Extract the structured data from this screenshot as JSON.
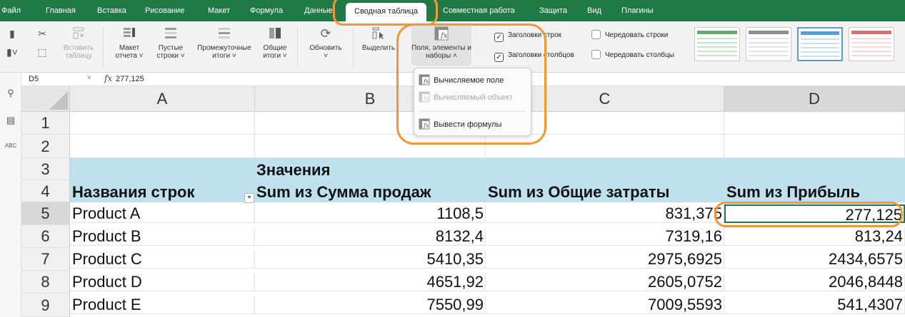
{
  "menubar": {
    "items": [
      "Файл",
      "Главная",
      "Вставка",
      "Рисование",
      "Макет",
      "Формула",
      "Данные",
      "Сводная таблица",
      "Совместная работа",
      "Защита",
      "Вид",
      "Плагины"
    ],
    "active": "Сводная таблица"
  },
  "ribbon": {
    "insert_table": "Вставить таблицу",
    "report_layout": "Макет отчета",
    "blank_rows": "Пустые строки",
    "subtotals": "Промежуточные итоги",
    "grand_totals": "Общие итоги",
    "refresh": "Обновить",
    "select": "Выделить",
    "fields_items_sets": "Поля, элементы и наборы",
    "row_headers": "Заголовки строк",
    "col_headers": "Заголовки столбцов",
    "banded_rows": "Чередовать строки",
    "banded_cols": "Чередовать столбцы",
    "row_headers_checked": true,
    "col_headers_checked": true,
    "banded_rows_checked": false,
    "banded_cols_checked": false
  },
  "dropdown": {
    "items": [
      {
        "label": "Вычисляемое поле",
        "enabled": true
      },
      {
        "label": "Вычисляемый объект",
        "enabled": false
      },
      {
        "label": "Вывести формулы",
        "enabled": true
      }
    ]
  },
  "formula_bar": {
    "name_box": "D5",
    "fx": "fx",
    "value": "277,125"
  },
  "sheet": {
    "columns": [
      "A",
      "B",
      "C",
      "D"
    ],
    "selected_column": "D",
    "rows": [
      "1",
      "2",
      "3",
      "4",
      "5",
      "6",
      "7",
      "8",
      "9"
    ],
    "selected_row": "5",
    "values_label": "Значения",
    "row_labels_header": "Названия строк",
    "headers": [
      "Sum из Сумма продаж",
      "Sum из Общие затраты",
      "Sum из Прибыль"
    ],
    "data": [
      {
        "product": "Product A",
        "sales": "1108,5",
        "costs": "831,375",
        "profit": "277,125"
      },
      {
        "product": "Product B",
        "sales": "8132,4",
        "costs": "7319,16",
        "profit": "813,24"
      },
      {
        "product": "Product C",
        "sales": "5410,35",
        "costs": "2975,6925",
        "profit": "2434,6575"
      },
      {
        "product": "Product D",
        "sales": "4651,92",
        "costs": "2605,0752",
        "profit": "2046,8448"
      },
      {
        "product": "Product E",
        "sales": "7550,99",
        "costs": "7009,5593",
        "profit": "541,4307"
      }
    ]
  },
  "colors": {
    "menubar": "#1f7a45",
    "highlight": "#f29738",
    "pivot_header_band": "#bfe1ee"
  }
}
